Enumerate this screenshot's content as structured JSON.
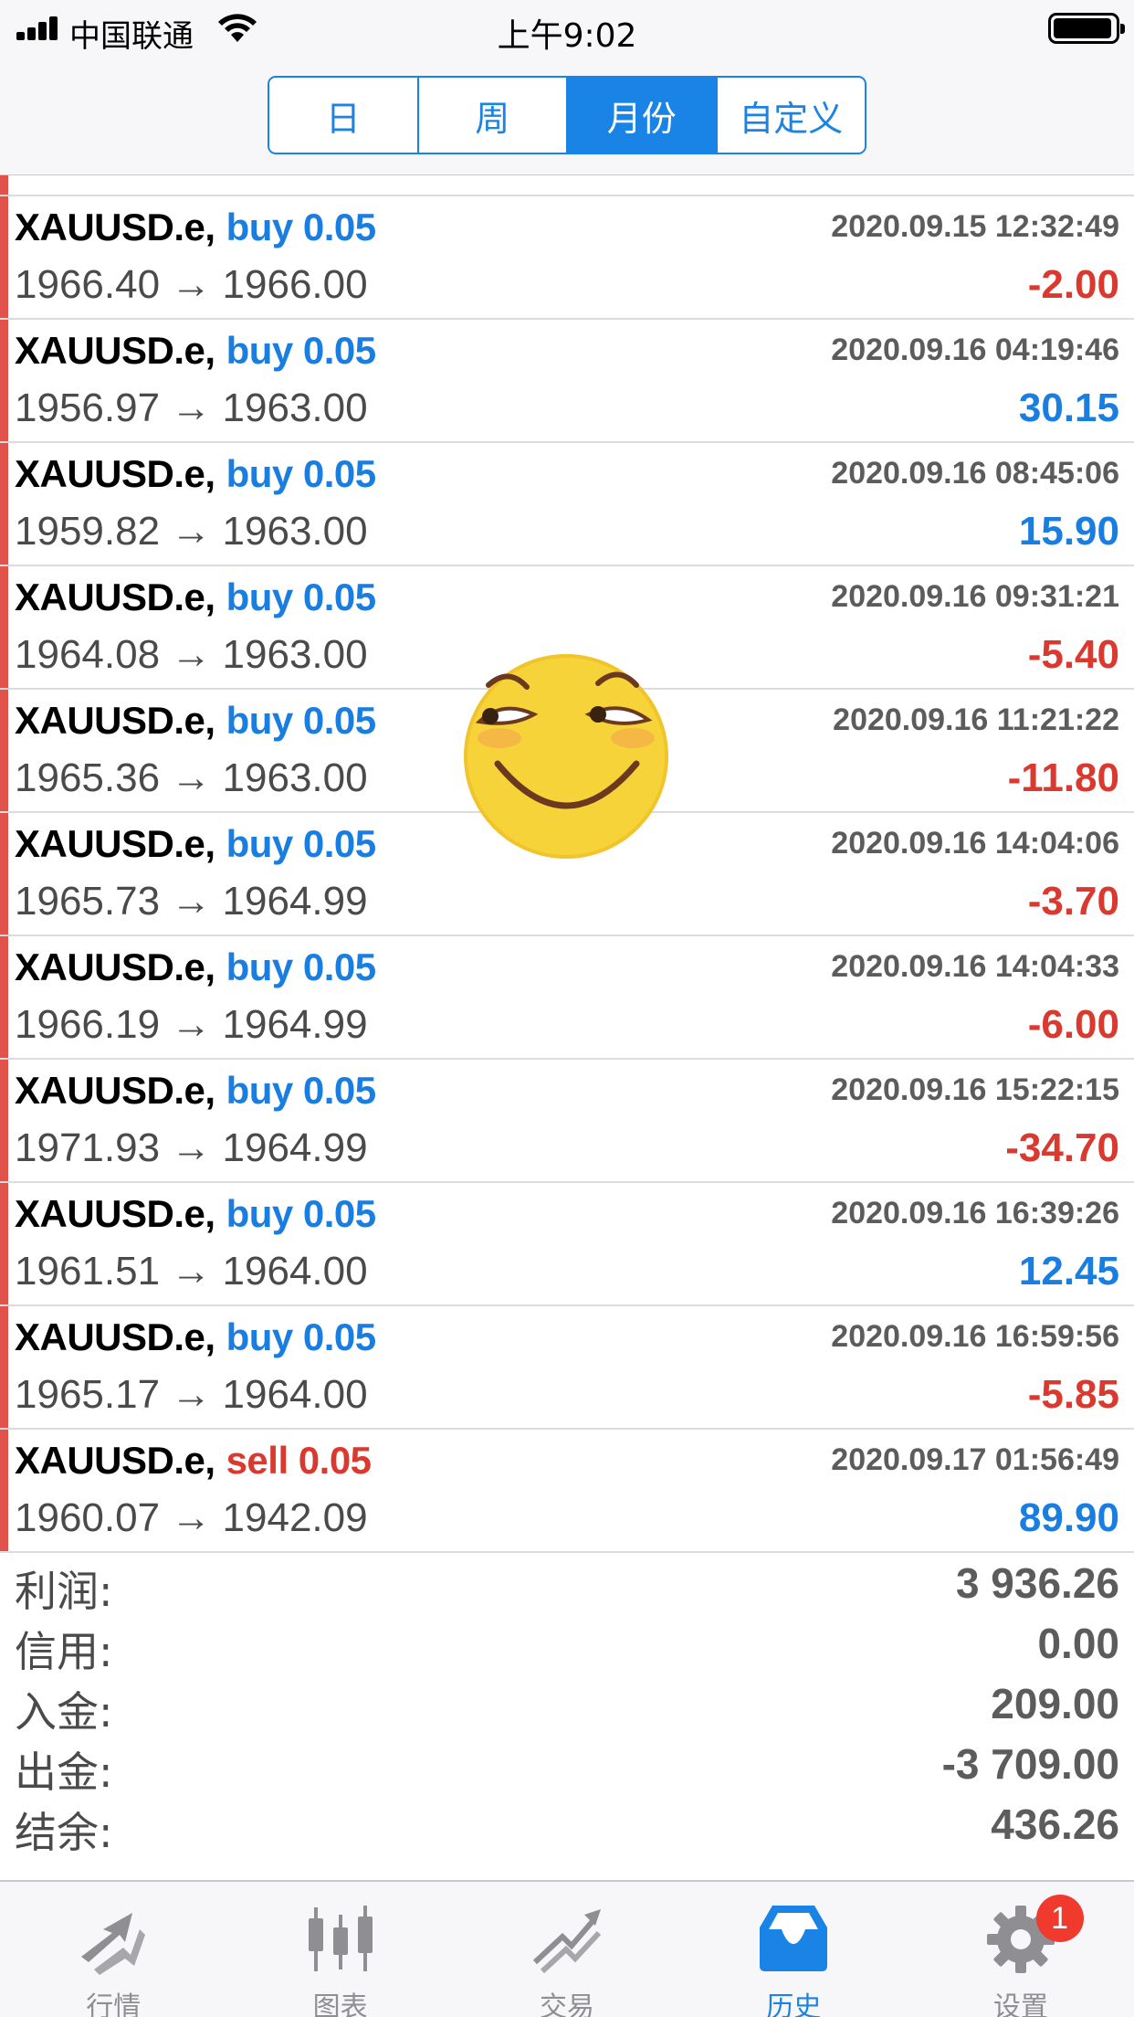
{
  "status_bar": {
    "carrier": "中国联通",
    "time": "上午9:02"
  },
  "period_tabs": [
    {
      "label": "日",
      "active": false
    },
    {
      "label": "周",
      "active": false
    },
    {
      "label": "月份",
      "active": true
    },
    {
      "label": "自定义",
      "active": false
    }
  ],
  "deals": [
    {
      "symbol": "XAUUSD.e,",
      "side": "buy",
      "volume": "0.05",
      "time": "2020.09.15 12:32:49",
      "open": "1966.40",
      "close": "1966.00",
      "profit": "-2.00"
    },
    {
      "symbol": "XAUUSD.e,",
      "side": "buy",
      "volume": "0.05",
      "time": "2020.09.16 04:19:46",
      "open": "1956.97",
      "close": "1963.00",
      "profit": "30.15"
    },
    {
      "symbol": "XAUUSD.e,",
      "side": "buy",
      "volume": "0.05",
      "time": "2020.09.16 08:45:06",
      "open": "1959.82",
      "close": "1963.00",
      "profit": "15.90"
    },
    {
      "symbol": "XAUUSD.e,",
      "side": "buy",
      "volume": "0.05",
      "time": "2020.09.16 09:31:21",
      "open": "1964.08",
      "close": "1963.00",
      "profit": "-5.40"
    },
    {
      "symbol": "XAUUSD.e,",
      "side": "buy",
      "volume": "0.05",
      "time": "2020.09.16 11:21:22",
      "open": "1965.36",
      "close": "1963.00",
      "profit": "-11.80"
    },
    {
      "symbol": "XAUUSD.e,",
      "side": "buy",
      "volume": "0.05",
      "time": "2020.09.16 14:04:06",
      "open": "1965.73",
      "close": "1964.99",
      "profit": "-3.70"
    },
    {
      "symbol": "XAUUSD.e,",
      "side": "buy",
      "volume": "0.05",
      "time": "2020.09.16 14:04:33",
      "open": "1966.19",
      "close": "1964.99",
      "profit": "-6.00"
    },
    {
      "symbol": "XAUUSD.e,",
      "side": "buy",
      "volume": "0.05",
      "time": "2020.09.16 15:22:15",
      "open": "1971.93",
      "close": "1964.99",
      "profit": "-34.70"
    },
    {
      "symbol": "XAUUSD.e,",
      "side": "buy",
      "volume": "0.05",
      "time": "2020.09.16 16:39:26",
      "open": "1961.51",
      "close": "1964.00",
      "profit": "12.45"
    },
    {
      "symbol": "XAUUSD.e,",
      "side": "buy",
      "volume": "0.05",
      "time": "2020.09.16 16:59:56",
      "open": "1965.17",
      "close": "1964.00",
      "profit": "-5.85"
    },
    {
      "symbol": "XAUUSD.e,",
      "side": "sell",
      "volume": "0.05",
      "time": "2020.09.17 01:56:49",
      "open": "1960.07",
      "close": "1942.09",
      "profit": "89.90"
    }
  ],
  "arrow": "→",
  "summary": {
    "profit_label": "利润:",
    "profit": "3 936.26",
    "credit_label": "信用:",
    "credit": "0.00",
    "deposit_label": "入金:",
    "deposit": "209.00",
    "withdrawal_label": "出金:",
    "withdrawal": "-3 709.00",
    "balance_label": "结余:",
    "balance": "436.26"
  },
  "tabbar": {
    "quotes": "行情",
    "chart": "图表",
    "trade": "交易",
    "history": "历史",
    "settings": "设置",
    "settings_badge": "1"
  },
  "colors": {
    "accent": "#1a84e6",
    "positive": "#1a7ee0",
    "negative": "#d9392f",
    "row_bar": "#e0524a"
  }
}
